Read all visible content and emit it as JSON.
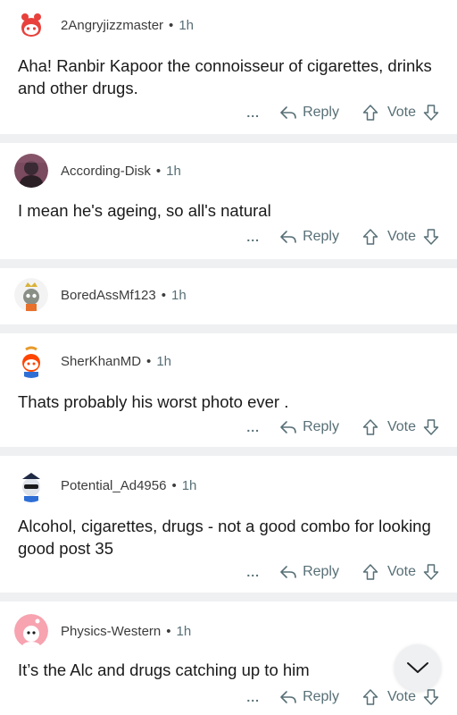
{
  "comments": [
    {
      "username": "2Angryjizzmaster",
      "time": "1h",
      "body": "Aha! Ranbir Kapoor the connoisseur of cigarettes, drinks and other drugs.",
      "reply": "Reply",
      "vote": "Vote",
      "more": "..."
    },
    {
      "username": "According-Disk",
      "time": "1h",
      "body": "I mean he's ageing, so all's natural",
      "reply": "Reply",
      "vote": "Vote",
      "more": "..."
    },
    {
      "username": "BoredAssMf123",
      "time": "1h"
    },
    {
      "username": "SherKhanMD",
      "time": "1h",
      "body": "Thats probably his worst photo ever .",
      "reply": "Reply",
      "vote": "Vote",
      "more": "..."
    },
    {
      "username": "Potential_Ad4956",
      "time": "1h",
      "body": "Alcohol, cigarettes, drugs - not a good combo for looking good post 35",
      "reply": "Reply",
      "vote": "Vote",
      "more": "..."
    },
    {
      "username": "Physics-Western",
      "time": "1h",
      "body": "It’s the Alc and drugs catching up to him",
      "reply": "Reply",
      "vote": "Vote",
      "more": "..."
    }
  ],
  "dot": "•",
  "icons": {
    "reply": "reply-arrow-icon",
    "upvote": "upvote-arrow-icon",
    "downvote": "downvote-arrow-icon",
    "scroll": "chevron-down-icon"
  }
}
